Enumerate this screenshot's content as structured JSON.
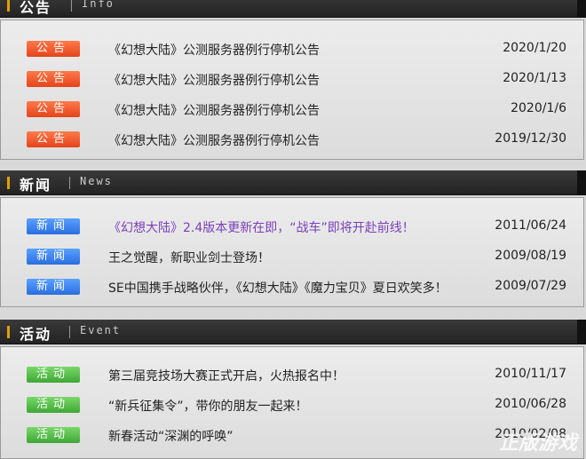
{
  "sections": [
    {
      "title": "公告",
      "en": "Info",
      "items": [
        {
          "badge": "公告",
          "title": "《幻想大陆》公测服务器例行停机公告",
          "date": "2020/1/20"
        },
        {
          "badge": "公告",
          "title": "《幻想大陆》公测服务器例行停机公告",
          "date": "2020/1/13"
        },
        {
          "badge": "公告",
          "title": "《幻想大陆》公测服务器例行停机公告",
          "date": "2020/1/6"
        },
        {
          "badge": "公告",
          "title": "《幻想大陆》公测服务器例行停机公告",
          "date": "2019/12/30"
        }
      ]
    },
    {
      "title": "新闻",
      "en": "News",
      "items": [
        {
          "badge": "新闻",
          "title": "《幻想大陆》2.4版本更新在即，“战车”即将开赴前线！",
          "date": "2011/06/24"
        },
        {
          "badge": "新闻",
          "title": "王之觉醒，新职业剑士登场！",
          "date": "2009/08/19"
        },
        {
          "badge": "新闻",
          "title": "SE中国携手战略伙伴，《幻想大陆》《魔力宝贝》夏日欢笑多！",
          "date": "2009/07/29"
        }
      ]
    },
    {
      "title": "活动",
      "en": "Event",
      "items": [
        {
          "badge": "活动",
          "title": "第三届竞技场大赛正式开启，火热报名中！",
          "date": "2010/11/17"
        },
        {
          "badge": "活动",
          "title": "“新兵征集令”，带你的朋友一起来！",
          "date": "2010/06/28"
        },
        {
          "badge": "活动",
          "title": "新春活动“深渊的呼唤”",
          "date": "2010/02/08"
        }
      ]
    }
  ],
  "colors": {
    "announce": "#e5431a",
    "news": "#2a6ee0",
    "event": "#3ea834",
    "highlight_title": "#7a3fb8"
  },
  "watermark": "正版游戏"
}
